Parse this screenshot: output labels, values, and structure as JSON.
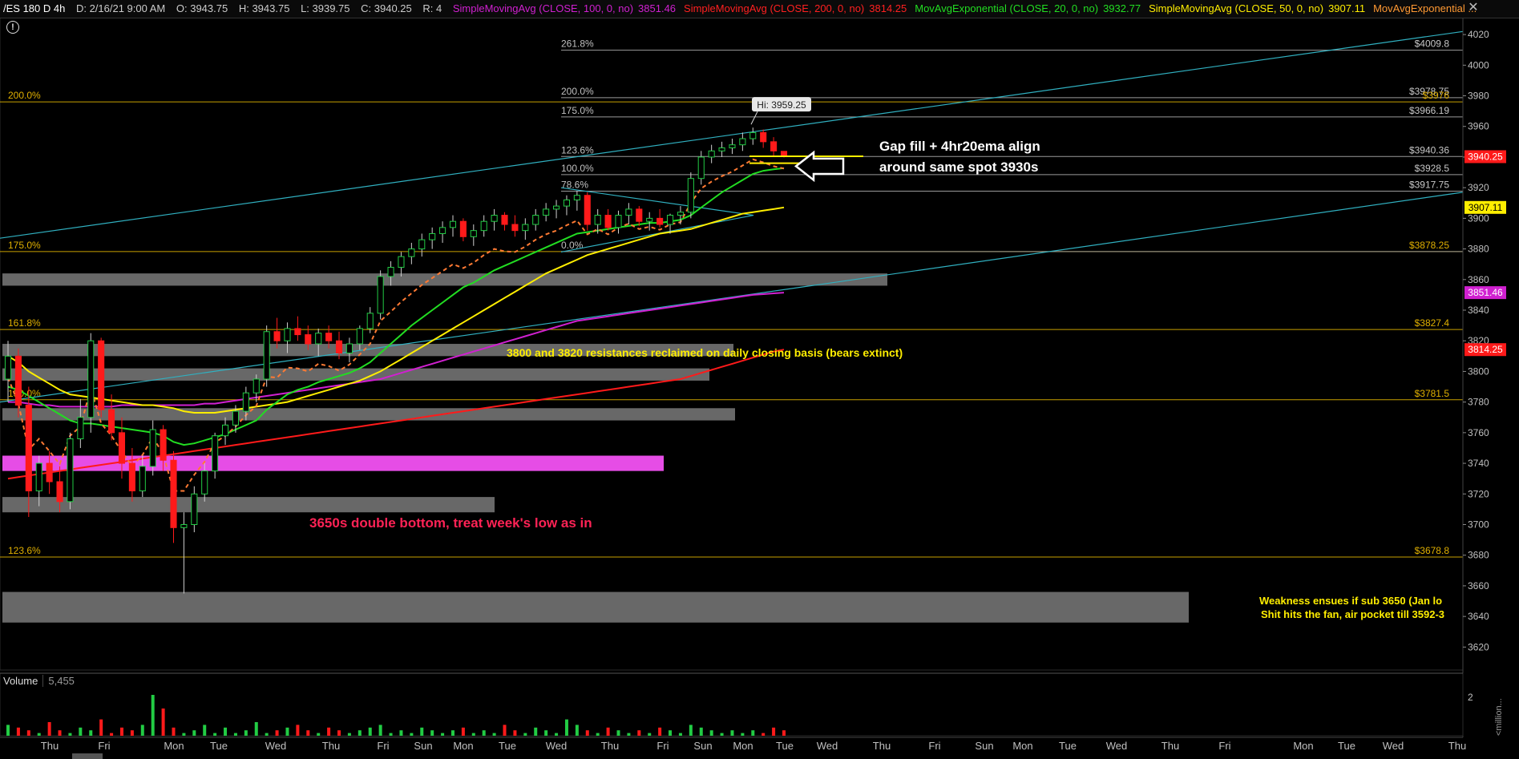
{
  "header": {
    "symbol": "/ES 180 D 4h",
    "date": "D: 2/16/21 9:00 AM",
    "open": "O: 3943.75",
    "high": "H: 3943.75",
    "low": "L: 3939.75",
    "close": "C: 3940.25",
    "r": "R: 4",
    "studies": [
      {
        "label": "SimpleMovingAvg (CLOSE, 100, 0, no)",
        "value": "3851.46",
        "color": "#d020d0"
      },
      {
        "label": "SimpleMovingAvg (CLOSE, 200, 0, no)",
        "value": "3814.25",
        "color": "#ff2020"
      },
      {
        "label": "MovAvgExponential (CLOSE, 20, 0, no)",
        "value": "3932.77",
        "color": "#22dd22"
      },
      {
        "label": "SimpleMovingAvg (CLOSE, 50, 0, no)",
        "value": "3907.11",
        "color": "#ffee00"
      },
      {
        "label": "MovAvgExponential ...",
        "value": "",
        "color": "#ff9933"
      }
    ]
  },
  "annotations": {
    "gap_fill_line1": "Gap fill + 4hr20ema align",
    "gap_fill_line2": "around same spot 3930s",
    "resistance_note": "3800 and 3820 resistances reclaimed on daily closing basis (bears extinct)",
    "double_bottom": "3650s double bottom, treat week's low as in",
    "weakness_line1": "Weakness ensues if sub 3650 (Jan lo",
    "weakness_line2": "Shit hits the fan, air pocket till 3592-3",
    "hi_label": "Hi: 3959.25",
    "alert_icon": "!"
  },
  "volume": {
    "label": "Volume",
    "value": "5,455",
    "scale_top": "2",
    "scale_unit": "<million..."
  },
  "colors": {
    "up": "#22cc44",
    "down": "#ff1a1a",
    "fib_yellow": "#c8a000",
    "fib_white": "#9a9a9a",
    "channel": "#30b0c0",
    "zone_gray": "#7a7a7a",
    "zone_pink": "#ff55ff",
    "bg": "#000000"
  },
  "chart_data": {
    "type": "candlestick",
    "title": "/ES 180 D 4h",
    "y_axis": {
      "ylim": [
        3605,
        4030
      ],
      "ticks": [
        3620,
        3640,
        3660,
        3680,
        3700,
        3720,
        3740,
        3760,
        3780,
        3800,
        3820,
        3840,
        3860,
        3880,
        3900,
        3920,
        3940,
        3960,
        3980,
        4000,
        4020
      ]
    },
    "x_tick_labels": [
      "Thu",
      "Fri",
      "Mon",
      "Tue",
      "Wed",
      "Thu",
      "Fri",
      "Sun",
      "Mon",
      "Tue",
      "Wed",
      "Thu",
      "Fri",
      "Sun",
      "Mon",
      "Tue",
      "Wed",
      "Thu",
      "Fri",
      "Sun",
      "Mon",
      "Tue",
      "Wed",
      "Thu",
      "Fri",
      "Mon",
      "Tue",
      "Wed",
      "Thu"
    ],
    "price_labels": [
      {
        "text": "$4009.8",
        "value": 4009.8,
        "color": "#c8c8c8"
      },
      {
        "text": "$3978.75",
        "value": 3978.75,
        "color": "#c8c8c8"
      },
      {
        "text": "$3976",
        "value": 3976,
        "color": "#e0b000"
      },
      {
        "text": "$3966.19",
        "value": 3966.19,
        "color": "#c8c8c8"
      },
      {
        "text": "$3940.36",
        "value": 3940.36,
        "color": "#c8c8c8"
      },
      {
        "text": "$3928.5",
        "value": 3928.5,
        "color": "#c8c8c8"
      },
      {
        "text": "$3917.75",
        "value": 3917.75,
        "color": "#c8c8c8"
      },
      {
        "text": "$3878.25",
        "value": 3878.25,
        "color": "#e0b000"
      },
      {
        "text": "$3827.4",
        "value": 3827.4,
        "color": "#e0b000"
      },
      {
        "text": "$3781.5",
        "value": 3781.5,
        "color": "#e0b000"
      },
      {
        "text": "$3678.8",
        "value": 3678.8,
        "color": "#e0b000"
      }
    ],
    "axis_badges": [
      {
        "text": "3940.25",
        "value": 3940.25,
        "bg": "#ff1a1a",
        "fg": "#ffffff"
      },
      {
        "text": "3907.11",
        "value": 3907.11,
        "bg": "#ffee00",
        "fg": "#000000"
      },
      {
        "text": "3851.46",
        "value": 3851.46,
        "bg": "#d020d0",
        "fg": "#ffffff"
      },
      {
        "text": "3814.25",
        "value": 3814.25,
        "bg": "#ff1a1a",
        "fg": "#ffffff"
      }
    ],
    "fib_levels_left": [
      {
        "label": "200.0%",
        "value": 3976
      },
      {
        "label": "175.0%",
        "value": 3878.25
      },
      {
        "label": "161.8%",
        "value": 3827.4
      },
      {
        "label": "150.0%",
        "value": 3781.5
      },
      {
        "label": "123.6%",
        "value": 3678.8
      }
    ],
    "fib_levels_right": [
      {
        "label": "261.8%",
        "value": 4009.8
      },
      {
        "label": "200.0%",
        "value": 3978.75
      },
      {
        "label": "175.0%",
        "value": 3966.19
      },
      {
        "label": "123.6%",
        "value": 3940.36
      },
      {
        "label": "100.0%",
        "value": 3928.5
      },
      {
        "label": "78.6%",
        "value": 3917.75
      },
      {
        "label": "0.0%",
        "value": 3878.25
      }
    ],
    "candles": [
      [
        3795,
        3820,
        3780,
        3810
      ],
      [
        3810,
        3815,
        3770,
        3778
      ],
      [
        3778,
        3790,
        3705,
        3722
      ],
      [
        3722,
        3745,
        3712,
        3740
      ],
      [
        3740,
        3748,
        3720,
        3728
      ],
      [
        3728,
        3738,
        3708,
        3715
      ],
      [
        3715,
        3760,
        3710,
        3756
      ],
      [
        3756,
        3782,
        3750,
        3770
      ],
      [
        3770,
        3825,
        3760,
        3820
      ],
      [
        3820,
        3822,
        3770,
        3775
      ],
      [
        3775,
        3785,
        3755,
        3760
      ],
      [
        3760,
        3770,
        3730,
        3740
      ],
      [
        3740,
        3750,
        3715,
        3722
      ],
      [
        3722,
        3745,
        3718,
        3738
      ],
      [
        3738,
        3768,
        3732,
        3762
      ],
      [
        3762,
        3765,
        3735,
        3742
      ],
      [
        3742,
        3748,
        3688,
        3698
      ],
      [
        3698,
        3708,
        3655,
        3700
      ],
      [
        3700,
        3725,
        3695,
        3720
      ],
      [
        3720,
        3740,
        3715,
        3735
      ],
      [
        3735,
        3760,
        3730,
        3758
      ],
      [
        3758,
        3770,
        3752,
        3765
      ],
      [
        3765,
        3778,
        3760,
        3774
      ],
      [
        3774,
        3790,
        3768,
        3786
      ],
      [
        3786,
        3798,
        3780,
        3795
      ],
      [
        3795,
        3830,
        3790,
        3826
      ],
      [
        3826,
        3835,
        3815,
        3820
      ],
      [
        3820,
        3832,
        3812,
        3828
      ],
      [
        3828,
        3836,
        3820,
        3824
      ],
      [
        3824,
        3830,
        3814,
        3818
      ],
      [
        3818,
        3828,
        3810,
        3825
      ],
      [
        3825,
        3830,
        3815,
        3820
      ],
      [
        3820,
        3826,
        3808,
        3812
      ],
      [
        3812,
        3822,
        3806,
        3818
      ],
      [
        3818,
        3830,
        3814,
        3828
      ],
      [
        3828,
        3842,
        3825,
        3838
      ],
      [
        3838,
        3866,
        3834,
        3862
      ],
      [
        3862,
        3872,
        3856,
        3868
      ],
      [
        3868,
        3878,
        3862,
        3875
      ],
      [
        3875,
        3884,
        3870,
        3880
      ],
      [
        3880,
        3890,
        3875,
        3886
      ],
      [
        3886,
        3894,
        3880,
        3890
      ],
      [
        3890,
        3898,
        3884,
        3894
      ],
      [
        3894,
        3902,
        3888,
        3898
      ],
      [
        3898,
        3900,
        3885,
        3888
      ],
      [
        3888,
        3896,
        3882,
        3892
      ],
      [
        3892,
        3902,
        3888,
        3898
      ],
      [
        3898,
        3906,
        3892,
        3902
      ],
      [
        3902,
        3904,
        3892,
        3896
      ],
      [
        3896,
        3902,
        3888,
        3892
      ],
      [
        3892,
        3900,
        3886,
        3896
      ],
      [
        3896,
        3906,
        3892,
        3902
      ],
      [
        3902,
        3910,
        3898,
        3906
      ],
      [
        3906,
        3912,
        3900,
        3908
      ],
      [
        3908,
        3915,
        3902,
        3912
      ],
      [
        3912,
        3918,
        3905,
        3915
      ],
      [
        3915,
        3917,
        3892,
        3896
      ],
      [
        3896,
        3906,
        3890,
        3902
      ],
      [
        3902,
        3906,
        3892,
        3894
      ],
      [
        3894,
        3905,
        3890,
        3902
      ],
      [
        3902,
        3910,
        3896,
        3906
      ],
      [
        3906,
        3908,
        3895,
        3898
      ],
      [
        3898,
        3904,
        3892,
        3900
      ],
      [
        3900,
        3906,
        3894,
        3896
      ],
      [
        3896,
        3903,
        3890,
        3902
      ],
      [
        3902,
        3908,
        3896,
        3904
      ],
      [
        3904,
        3930,
        3900,
        3926
      ],
      [
        3926,
        3944,
        3922,
        3940
      ],
      [
        3940,
        3948,
        3936,
        3944
      ],
      [
        3944,
        3950,
        3940,
        3946
      ],
      [
        3946,
        3952,
        3942,
        3948
      ],
      [
        3948,
        3956,
        3944,
        3952
      ],
      [
        3952,
        3959.25,
        3948,
        3956
      ],
      [
        3956,
        3958,
        3946,
        3950
      ],
      [
        3950,
        3953,
        3940,
        3944
      ],
      [
        3943.75,
        3943.75,
        3939.75,
        3940.25
      ]
    ],
    "ema20": [
      3790,
      3788,
      3784,
      3780,
      3776,
      3772,
      3768,
      3766,
      3766,
      3765,
      3764,
      3763,
      3762,
      3761,
      3760,
      3758,
      3754,
      3752,
      3753,
      3755,
      3757,
      3759,
      3762,
      3765,
      3768,
      3775,
      3780,
      3785,
      3788,
      3790,
      3793,
      3795,
      3797,
      3799,
      3802,
      3806,
      3812,
      3818,
      3824,
      3830,
      3835,
      3840,
      3845,
      3850,
      3855,
      3858,
      3862,
      3866,
      3869,
      3872,
      3875,
      3878,
      3881,
      3884,
      3887,
      3890,
      3891,
      3892,
      3893,
      3894,
      3895,
      3896,
      3897,
      3897,
      3898,
      3899,
      3902,
      3907,
      3912,
      3917,
      3921,
      3925,
      3929,
      3931,
      3932,
      3932.77
    ],
    "sma50": [
      3810,
      3806,
      3800,
      3796,
      3792,
      3788,
      3785,
      3784,
      3783,
      3782,
      3781,
      3780,
      3779,
      3778,
      3778,
      3777,
      3776,
      3774,
      3773,
      3773,
      3773,
      3774,
      3775,
      3776,
      3777,
      3778,
      3779,
      3780,
      3782,
      3784,
      3786,
      3788,
      3790,
      3792,
      3794,
      3797,
      3800,
      3804,
      3808,
      3812,
      3816,
      3820,
      3824,
      3828,
      3832,
      3836,
      3840,
      3844,
      3848,
      3852,
      3856,
      3860,
      3864,
      3867,
      3870,
      3873,
      3876,
      3878,
      3880,
      3882,
      3884,
      3886,
      3888,
      3890,
      3891,
      3892,
      3893,
      3895,
      3897,
      3899,
      3901,
      3903,
      3904,
      3905,
      3906,
      3907.11
    ],
    "sma100": [
      3780,
      3780,
      3779,
      3778,
      3778,
      3777,
      3777,
      3777,
      3777,
      3777,
      3777,
      3778,
      3778,
      3778,
      3778,
      3778,
      3778,
      3778,
      3778,
      3779,
      3779,
      3780,
      3781,
      3782,
      3783,
      3784,
      3785,
      3786,
      3787,
      3788,
      3789,
      3790,
      3791,
      3792,
      3793,
      3794,
      3795,
      3797,
      3799,
      3801,
      3803,
      3805,
      3807,
      3809,
      3811,
      3813,
      3815,
      3817,
      3819,
      3821,
      3823,
      3825,
      3827,
      3829,
      3831,
      3833,
      3834,
      3835,
      3836,
      3837,
      3838,
      3839,
      3840,
      3841,
      3842,
      3843,
      3844,
      3845,
      3846,
      3847,
      3848,
      3849,
      3850,
      3850.5,
      3851,
      3851.46
    ],
    "sma200": [
      3730,
      3731,
      3732,
      3733,
      3734,
      3735,
      3736,
      3737,
      3738,
      3739,
      3740,
      3741,
      3742,
      3743,
      3744,
      3745,
      3746,
      3747,
      3748,
      3749,
      3750,
      3751,
      3752,
      3753,
      3754,
      3755,
      3756,
      3757,
      3758,
      3759,
      3760,
      3761,
      3762,
      3763,
      3764,
      3765,
      3766,
      3767,
      3768,
      3769,
      3770,
      3771,
      3772,
      3773,
      3774,
      3775,
      3776,
      3777,
      3778,
      3779,
      3780,
      3781,
      3782,
      3783,
      3784,
      3785,
      3786,
      3787,
      3788,
      3789,
      3790,
      3791,
      3792,
      3793,
      3794,
      3795,
      3797,
      3799,
      3801,
      3803,
      3805,
      3807,
      3809,
      3811,
      3813,
      3814.25
    ],
    "volume_bars": [
      0.4,
      0.3,
      0.2,
      0.1,
      0.5,
      0.2,
      0.1,
      0.3,
      0.2,
      0.6,
      0.1,
      0.3,
      0.2,
      0.4,
      1.5,
      1.0,
      0.3,
      0.1,
      0.2,
      0.4,
      0.1,
      0.3,
      0.1,
      0.2,
      0.5,
      0.1,
      0.2,
      0.3,
      0.4,
      0.2,
      0.1,
      0.3,
      0.2,
      0.1,
      0.2,
      0.3,
      0.4,
      0.1,
      0.2,
      0.1,
      0.3,
      0.2,
      0.1,
      0.2,
      0.3,
      0.1,
      0.2,
      0.1,
      0.4,
      0.2,
      0.1,
      0.3,
      0.2,
      0.1,
      0.6,
      0.4,
      0.2,
      0.1,
      0.3,
      0.2,
      0.1,
      0.2,
      0.1,
      0.3,
      0.2,
      0.1,
      0.4,
      0.3,
      0.2,
      0.1,
      0.2,
      0.1,
      0.2,
      0.1,
      0.3,
      0.2
    ]
  }
}
